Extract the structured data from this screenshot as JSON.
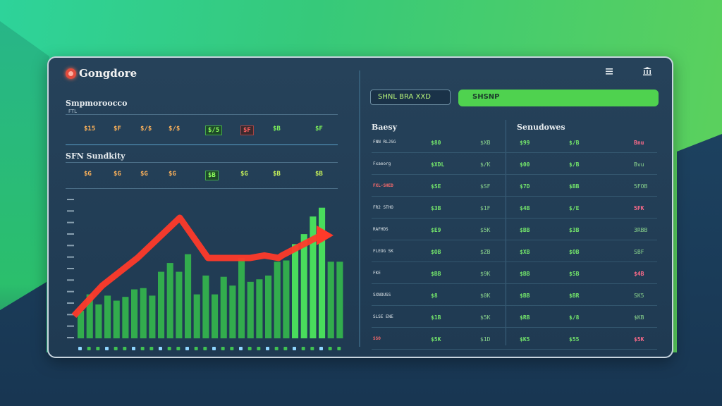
{
  "app": {
    "brand": "Gongdore",
    "icons": [
      "list-icon",
      "bank-icon"
    ]
  },
  "left": {
    "section1": {
      "title": "Smpmoroocco",
      "subtitle": "FTL",
      "values": [
        "$15",
        "$F",
        "$/$",
        "$/$",
        "$/5",
        "$F",
        "$B",
        "$F"
      ]
    },
    "section2": {
      "title": "SFN Sundkity",
      "values": [
        "$G",
        "$G",
        "$G",
        "$G",
        "$B",
        "$G",
        "$B",
        "$B"
      ]
    },
    "chart_data": {
      "type": "bar",
      "title": "",
      "xlabel": "",
      "ylabel": "",
      "series": [
        {
          "values": [
            22,
            35,
            27,
            34,
            30,
            33,
            39,
            40,
            34,
            53,
            60,
            53,
            67,
            35,
            50,
            35,
            49,
            42,
            64,
            45,
            47,
            50,
            61,
            62,
            75,
            83,
            97,
            104,
            61,
            61
          ]
        }
      ],
      "overlay_trend": {
        "color": "#ff3a2a",
        "values": [
          18,
          42,
          64,
          96,
          64,
          64,
          66,
          64,
          66,
          82
        ]
      },
      "ylim": [
        0,
        110
      ],
      "y_ticks": [
        "",
        "",
        "",
        "",
        "",
        "",
        "",
        "",
        "",
        "",
        "",
        "",
        ""
      ]
    }
  },
  "search": {
    "placeholder": "SHNL BRA XXD",
    "button_label": "SHSNP"
  },
  "right": {
    "col1_head": "Baesy",
    "col2_head": "Senudowes",
    "rows": [
      {
        "a": "FNN RLJSG",
        "b": "$80",
        "c": "$XB",
        "d": "$99",
        "e": "$/B",
        "f": "Bnu"
      },
      {
        "a": "Fxaeorg",
        "b": "$XDL",
        "c": "$/K",
        "d": "$00",
        "e": "$/B",
        "f": "Bvu"
      },
      {
        "a": "FXL-SHED",
        "b": "$SE",
        "c": "$SF",
        "d": "$7D",
        "e": "$BB",
        "f": "5FOB"
      },
      {
        "a": "FR2 STHO",
        "b": "$3B",
        "c": "$1F",
        "d": "$4B",
        "e": "$/E",
        "f": "5FK"
      },
      {
        "a": "RAFHDS",
        "b": "$E9",
        "c": "$5K",
        "d": "$BB",
        "e": "$3B",
        "f": "3RBB"
      },
      {
        "a": "FLEOG SK",
        "b": "$OB",
        "c": "$ZB",
        "d": "$XB",
        "e": "$OB",
        "f": "SBF"
      },
      {
        "a": "FKE",
        "b": "$BB",
        "c": "$9K",
        "d": "$BB",
        "e": "$5B",
        "f": "$4B"
      },
      {
        "a": "SXNOUSS",
        "b": "$8",
        "c": "$0K",
        "d": "$BB",
        "e": "$BR",
        "f": "SK5"
      },
      {
        "a": "SLSE ENE",
        "b": "$1B",
        "c": "$5K",
        "d": "$RB",
        "e": "$/8",
        "f": "$KB"
      },
      {
        "a": "SSO",
        "b": "$5K",
        "c": "$1D",
        "d": "$K5",
        "e": "$55",
        "f": "$5K"
      }
    ]
  },
  "colors": {
    "accent": "#4fd24f",
    "trend": "#ff3a2a",
    "bar": "#3fc152",
    "window": "#23405a"
  }
}
